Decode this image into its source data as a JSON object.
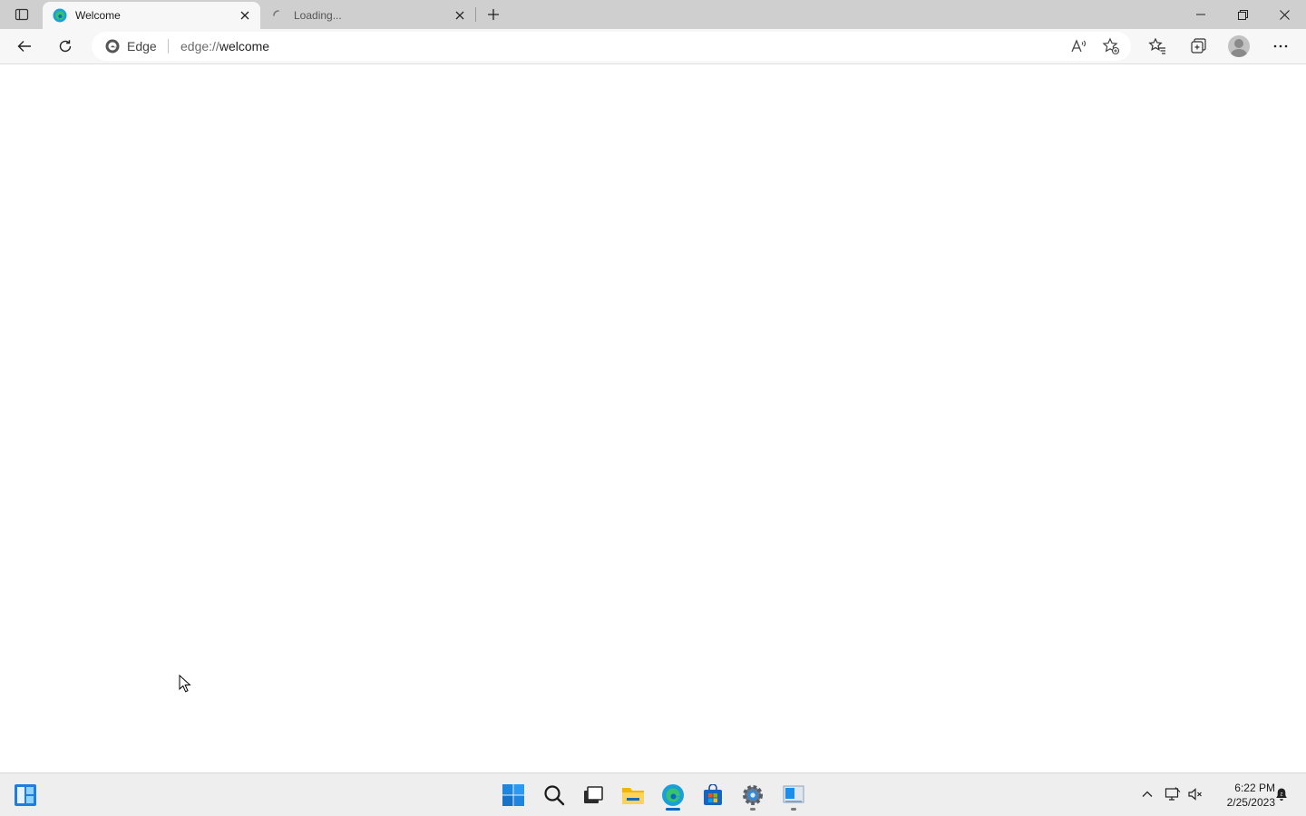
{
  "browser": {
    "tabs": [
      {
        "title": "Welcome",
        "active": true,
        "favicon": "edge-logo-icon"
      },
      {
        "title": "Loading...",
        "active": false,
        "favicon": "loading-spinner-icon"
      }
    ],
    "address": {
      "site_label": "Edge",
      "url_scheme": "edge://",
      "url_rest": "welcome"
    }
  },
  "taskbar": {
    "clock": {
      "time": "6:22 PM",
      "date": "2/25/2023"
    },
    "pinned": [
      "widgets-icon",
      "start-icon",
      "search-icon",
      "task-view-icon",
      "file-explorer-icon",
      "edge-icon",
      "store-icon",
      "settings-icon",
      "app-icon"
    ]
  },
  "colors": {
    "tabstrip": "#cfcfcf",
    "toolbar": "#f7f7f7",
    "windows_blue": "#0078d4",
    "taskbar": "#eeeeee"
  }
}
